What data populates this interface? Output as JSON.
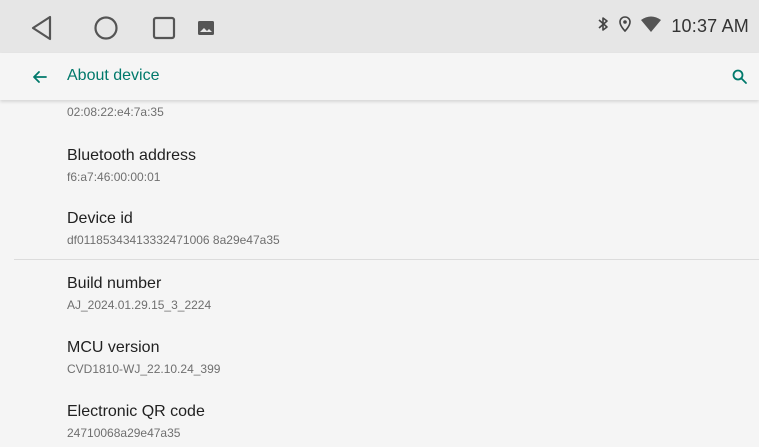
{
  "status_bar": {
    "time": "10:37 AM",
    "icons": [
      "bluetooth-icon",
      "location-icon",
      "wifi-icon"
    ]
  },
  "nav": {
    "icons": [
      "back-triangle-icon",
      "home-circle-icon",
      "recents-square-icon",
      "gallery-icon"
    ]
  },
  "app_bar": {
    "title": "About device",
    "back_icon": "arrow-left-icon",
    "search_icon": "search-icon",
    "accent_color": "#00796b"
  },
  "items": [
    {
      "title": "",
      "value": "02:08:22:e4:7a:35"
    },
    {
      "title": "Bluetooth address",
      "value": "f6:a7:46:00:00:01"
    },
    {
      "title": "Device id",
      "value": "df01185343413332471006 8a29e47a35"
    },
    {
      "title": "Build number",
      "value": "AJ_2024.01.29.15_3_2224"
    },
    {
      "title": "MCU version",
      "value": "CVD1810-WJ_22.10.24_399"
    },
    {
      "title": "Electronic QR code",
      "value": "24710068a29e47a35"
    }
  ]
}
